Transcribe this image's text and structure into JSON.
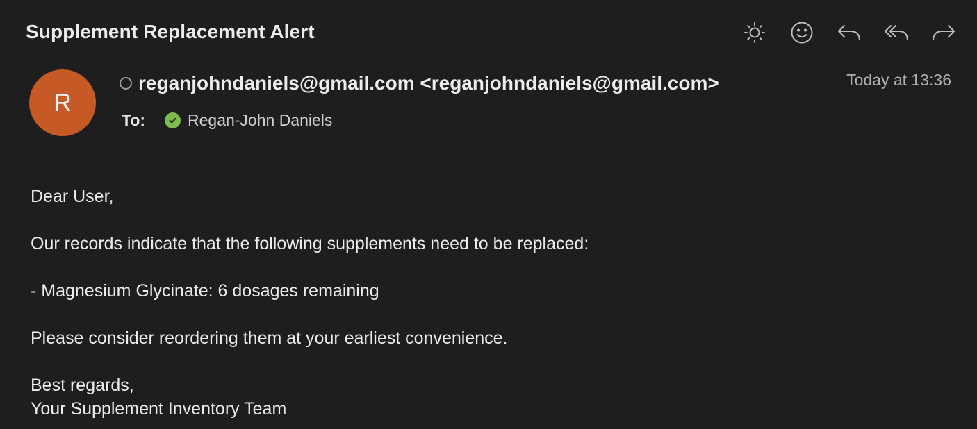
{
  "email": {
    "subject": "Supplement Replacement Alert",
    "sender_display": "reganjohndaniels@gmail.com <reganjohndaniels@gmail.com>",
    "avatar_initial": "R",
    "timestamp": "Today at 13:36",
    "to_label": "To:",
    "recipient": "Regan-John Daniels",
    "body": {
      "greeting": "Dear User,",
      "line1": "Our records indicate that the following supplements need to be replaced:",
      "item1": "- Magnesium Glycinate: 6 dosages remaining",
      "line2": "Please consider reordering them at your earliest convenience.",
      "signoff": "Best regards,",
      "signature": "Your Supplement Inventory Team"
    }
  },
  "toolbar": {
    "icons": [
      "brightness-icon",
      "emoji-icon",
      "reply-icon",
      "reply-all-icon",
      "forward-icon"
    ]
  },
  "colors": {
    "background": "#1e1e1e",
    "avatar": "#c65a27",
    "verified": "#7fba4d",
    "text": "#ececec",
    "muted": "#b0b0b0"
  }
}
